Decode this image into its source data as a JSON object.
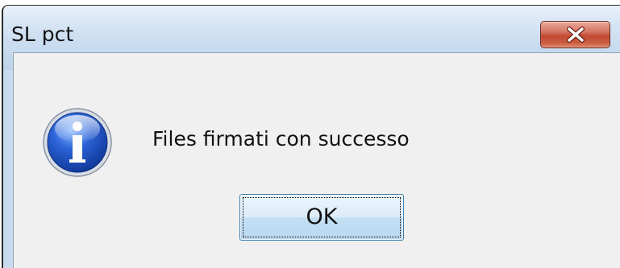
{
  "window": {
    "title": "SL pct",
    "close_icon": "close-x-icon"
  },
  "dialog": {
    "icon": "info-icon",
    "message": "Files firmati con successo",
    "ok_label": "OK"
  },
  "colors": {
    "titlebar": "#c9dcf0",
    "client_bg": "#f0f0f0",
    "close_button": "#c24a32",
    "ok_button_border": "#3c7fb1",
    "info_icon_blue": "#1f4db7"
  }
}
